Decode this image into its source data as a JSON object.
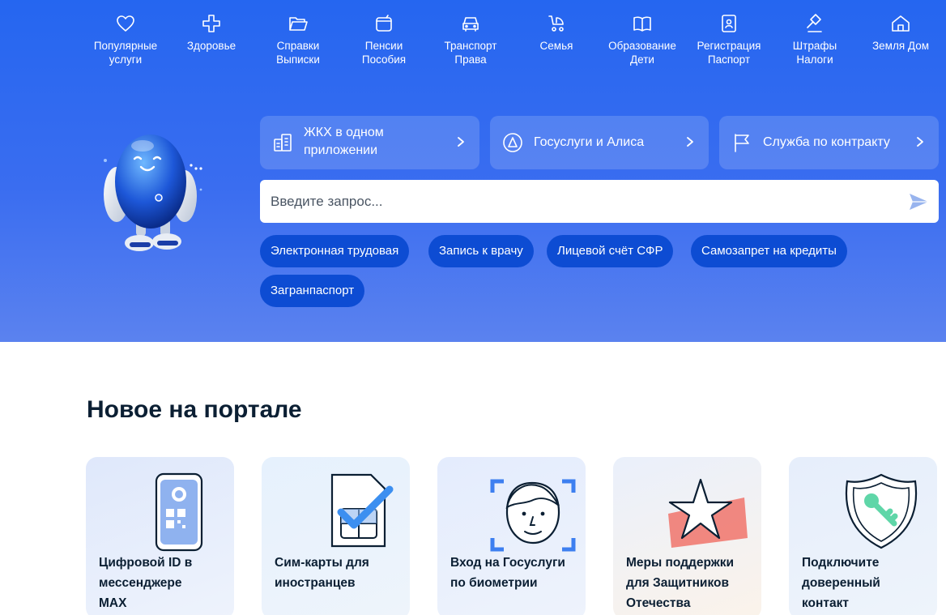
{
  "nav": {
    "categories": [
      {
        "label": "Популярные услуги",
        "icon": "heart-icon"
      },
      {
        "label": "Здоровье",
        "icon": "medical-cross-icon"
      },
      {
        "label": "Справки Выписки",
        "icon": "folder-icon"
      },
      {
        "label": "Пенсии Пособия",
        "icon": "wallet-icon"
      },
      {
        "label": "Транспорт Права",
        "icon": "car-icon"
      },
      {
        "label": "Семья",
        "icon": "stroller-icon"
      },
      {
        "label": "Образование Дети",
        "icon": "book-icon"
      },
      {
        "label": "Регистрация Паспорт",
        "icon": "id-card-icon"
      },
      {
        "label": "Штрафы Налоги",
        "icon": "gavel-icon"
      },
      {
        "label": "Земля Дом",
        "icon": "house-icon"
      }
    ]
  },
  "quick_links": [
    {
      "label": "ЖКХ в одном приложении",
      "icon": "building-icon"
    },
    {
      "label": "Госуслуги и Алиса",
      "icon": "alice-icon"
    },
    {
      "label": "Служба по контракту",
      "icon": "flag-icon"
    }
  ],
  "search": {
    "placeholder": "Введите запрос...",
    "value": ""
  },
  "chips": [
    "Электронная трудовая",
    "Запись к врачу",
    "Лицевой счёт СФР",
    "Самозапрет на кредиты",
    "Загранпаспорт"
  ],
  "news": {
    "title": "Новое на портале",
    "cards": [
      {
        "label": "Цифровой ID в мессенджере MAX",
        "icon": "phone-qr-icon"
      },
      {
        "label": "Сим-карты для иностранцев",
        "icon": "sim-card-icon"
      },
      {
        "label": "Вход на Госуслуги по биометрии",
        "icon": "face-scan-icon"
      },
      {
        "label": "Меры поддержки для Защитников Отечества",
        "icon": "star-icon"
      },
      {
        "label": "Подключите доверенный контакт",
        "icon": "shield-key-icon"
      }
    ]
  },
  "colors": {
    "hero_top": "#2566f0",
    "hero_bottom": "#5b82ef",
    "chip": "#0d4cd3",
    "text": "#0b1f33"
  }
}
